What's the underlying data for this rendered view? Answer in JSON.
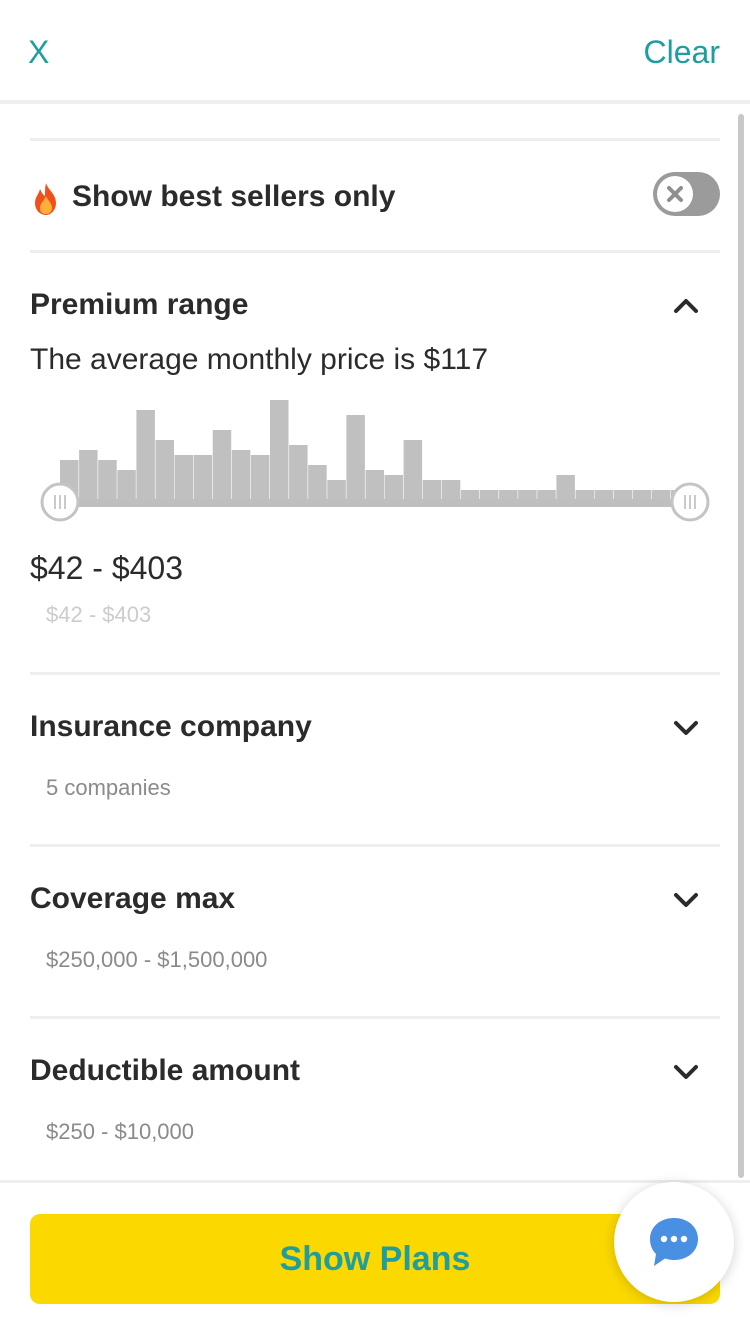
{
  "header": {
    "close_label": "X",
    "clear_label": "Clear"
  },
  "best_sellers": {
    "label": "Show best sellers only",
    "icon": "flame-icon",
    "toggle_on": false
  },
  "premium": {
    "title": "Premium range",
    "average_text": "The average monthly price is $117",
    "range_text": "$42 - $403",
    "range_subtext": "$42 - $403",
    "expanded": true,
    "histogram_bar_heights": [
      40,
      50,
      40,
      30,
      90,
      60,
      45,
      45,
      70,
      50,
      45,
      100,
      55,
      35,
      20,
      85,
      30,
      25,
      60,
      20,
      20,
      10,
      10,
      10,
      10,
      10,
      25,
      10,
      10,
      10,
      10,
      10,
      10
    ]
  },
  "insurance_company": {
    "title": "Insurance company",
    "summary": "5 companies"
  },
  "coverage_max": {
    "title": "Coverage max",
    "summary": "$250,000 - $1,500,000"
  },
  "deductible": {
    "title": "Deductible amount",
    "summary": "$250 - $10,000"
  },
  "footer": {
    "cta_label": "Show Plans"
  },
  "colors": {
    "accent": "#1e9e9e",
    "cta": "#fbd800",
    "chat": "#4a90e2"
  }
}
